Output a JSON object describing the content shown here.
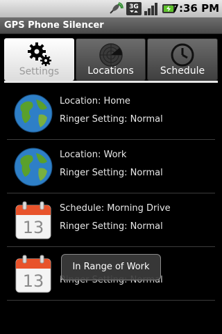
{
  "status_bar": {
    "time": "7:36 PM",
    "icons": [
      "gps-satellite-icon",
      "3g-data-icon",
      "signal-strength-icon",
      "battery-charging-icon"
    ]
  },
  "app": {
    "title": "GPS Phone Silencer"
  },
  "tabs": [
    {
      "label": "Settings",
      "icon": "gears-icon",
      "selected": true
    },
    {
      "label": "Locations",
      "icon": "radar-icon",
      "selected": false
    },
    {
      "label": "Schedule",
      "icon": "clock-icon",
      "selected": false
    }
  ],
  "items": [
    {
      "icon": "globe-icon",
      "line1": "Location: Home",
      "line2": "Ringer Setting: Normal"
    },
    {
      "icon": "globe-icon",
      "line1": "Location: Work",
      "line2": "Ringer Setting: Normal"
    },
    {
      "icon": "calendar-icon",
      "calendar_day": "13",
      "line1": "Schedule: Morning Drive",
      "line2": "Ringer Setting: Normal"
    },
    {
      "icon": "calendar-icon",
      "calendar_day": "13",
      "line1": "",
      "line2": "Ringer Setting: Normal"
    }
  ],
  "toast": {
    "text": "In Range of Work"
  },
  "colors": {
    "tab_active_bg": "#ffffff",
    "tab_inactive_bg": "#555555",
    "toast_bg": "#3c3c3c"
  }
}
